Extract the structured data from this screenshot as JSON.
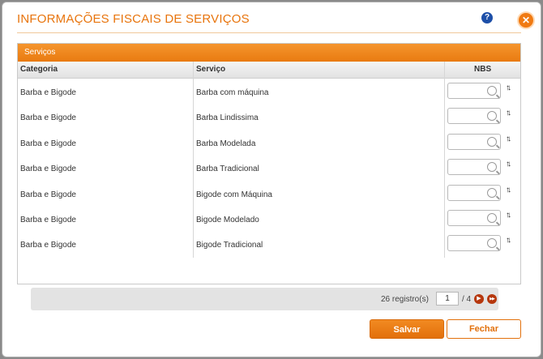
{
  "dialog": {
    "title": "INFORMAÇÕES FISCAIS DE SERVIÇOS",
    "help_glyph": "?",
    "close_glyph": "✕"
  },
  "panel": {
    "header": "Serviços",
    "columns": {
      "category": "Categoria",
      "service": "Serviço",
      "nbs": "NBS"
    },
    "rows": [
      {
        "category": "Barba e Bigode",
        "service": "Barba com máquina",
        "nbs": ""
      },
      {
        "category": "Barba e Bigode",
        "service": "Barba Lindissima",
        "nbs": ""
      },
      {
        "category": "Barba e Bigode",
        "service": "Barba Modelada",
        "nbs": ""
      },
      {
        "category": "Barba e Bigode",
        "service": "Barba Tradicional",
        "nbs": ""
      },
      {
        "category": "Barba e Bigode",
        "service": "Bigode com Máquina",
        "nbs": ""
      },
      {
        "category": "Barba e Bigode",
        "service": "Bigode Modelado",
        "nbs": ""
      },
      {
        "category": "Barba e Bigode",
        "service": "Bigode Tradicional",
        "nbs": ""
      }
    ]
  },
  "pager": {
    "records": "26 registro(s)",
    "current_page": "1",
    "total_pages": "/ 4",
    "next_glyph": "▶",
    "last_glyph": "▶▶"
  },
  "buttons": {
    "save": "Salvar",
    "close": "Fechar"
  },
  "colors": {
    "accent": "#e8740c",
    "nav": "#b6370d",
    "help": "#1d4fa8"
  },
  "icons": {
    "help": "help-icon",
    "close": "close-icon",
    "search": "search-icon",
    "sort": "sort-arrows-icon",
    "next": "next-page-icon",
    "last": "last-page-icon"
  }
}
